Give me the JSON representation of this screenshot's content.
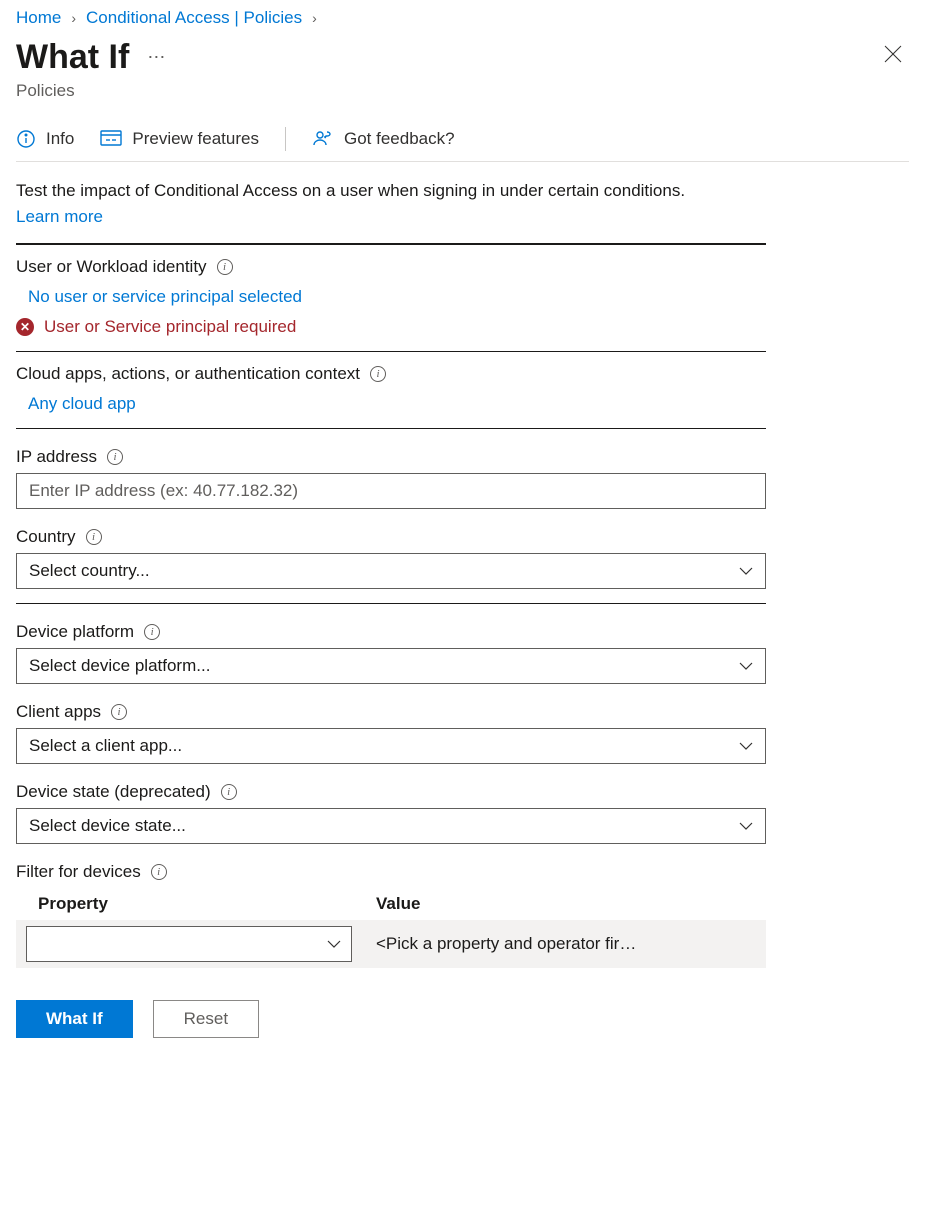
{
  "breadcrumb": {
    "home": "Home",
    "ca": "Conditional Access | Policies"
  },
  "header": {
    "title": "What If",
    "subtitle": "Policies"
  },
  "cmdbar": {
    "info": "Info",
    "preview": "Preview features",
    "feedback": "Got feedback?"
  },
  "intro": {
    "text": "Test the impact of Conditional Access on a user when signing in under certain conditions. ",
    "learn": "Learn more"
  },
  "user_section": {
    "label": "User or Workload identity",
    "link": "No user or service principal selected",
    "error": "User or Service principal required"
  },
  "cloud_section": {
    "label": "Cloud apps, actions, or authentication context",
    "link": "Any cloud app"
  },
  "ip": {
    "label": "IP address",
    "placeholder": "Enter IP address (ex: 40.77.182.32)"
  },
  "country": {
    "label": "Country",
    "value": "Select country..."
  },
  "platform": {
    "label": "Device platform",
    "value": "Select device platform..."
  },
  "client": {
    "label": "Client apps",
    "value": "Select a client app..."
  },
  "state": {
    "label": "Device state (deprecated)",
    "value": "Select device state..."
  },
  "filter": {
    "label": "Filter for devices",
    "col_property": "Property",
    "col_value": "Value",
    "value_placeholder": "<Pick a property and operator fir…"
  },
  "footer": {
    "whatif": "What If",
    "reset": "Reset"
  }
}
